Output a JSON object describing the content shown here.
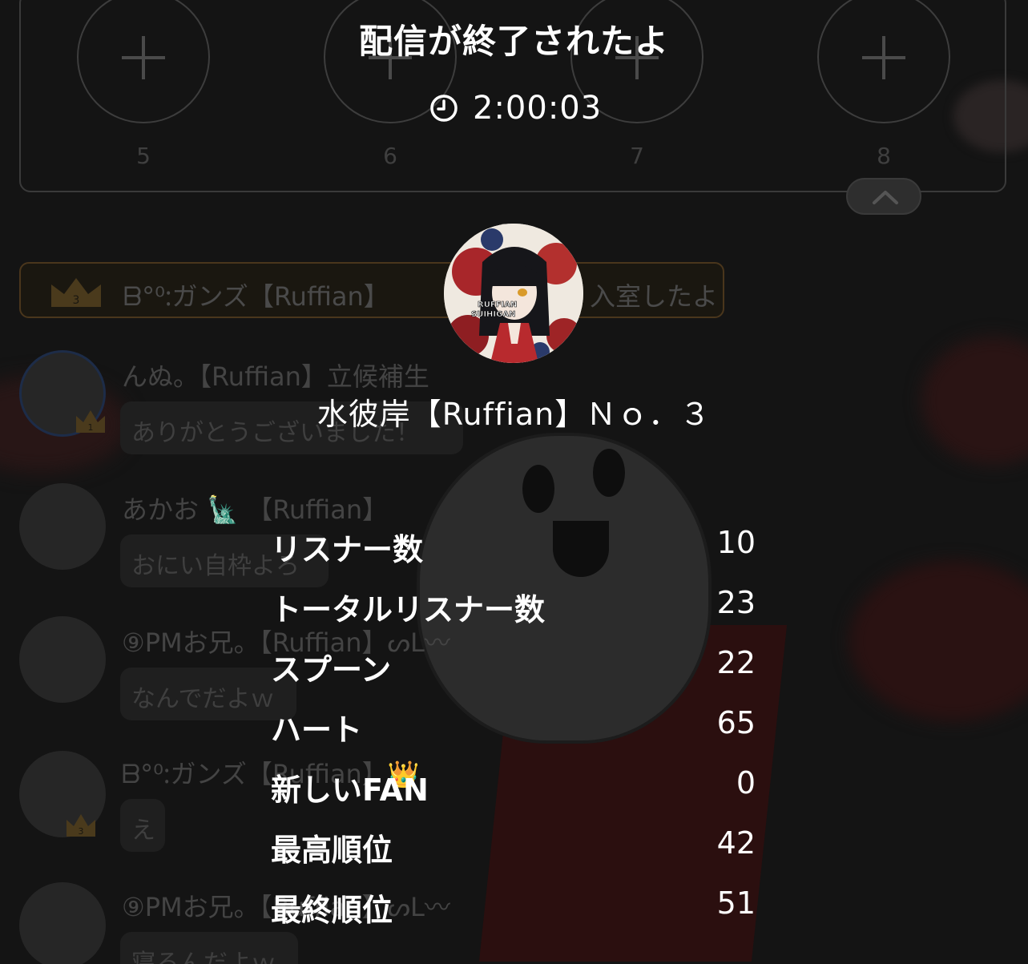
{
  "slots": [
    {
      "number": "5"
    },
    {
      "number": "6"
    },
    {
      "number": "7"
    },
    {
      "number": "8"
    }
  ],
  "entry_notice": {
    "text": "ᗷ°⁰ᱺガンズ【Ruffian】",
    "tail": "入室したよ",
    "crown_rank": "3"
  },
  "chat": [
    {
      "name": "んぬ。【Ruffian】立候補生",
      "message": "ありがとうございました！",
      "badge": "1"
    },
    {
      "name": "あかお 🗽 【Ruffian】",
      "message": "おにい自枠よろ"
    },
    {
      "name": "⑨PMお兄。【Ruffian】ᔕᒪ〰",
      "message": "なんでだよｗ"
    },
    {
      "name": "ᗷ°⁰ᱺガンズ【Ruffian】👑",
      "message": "え",
      "badge": "3"
    },
    {
      "name": "⑨PMお兄。【Ruffian】ᔕᒪ〰",
      "message": "寝るんだよｗ"
    }
  ],
  "summary": {
    "title": "配信が終了されたよ",
    "duration": "2:00:03",
    "streamer_name": "水彼岸【Ruffian】Ｎｏ．３",
    "avatar_text_top": "RUFFIAN",
    "avatar_text_bottom": "SUIHIGAN",
    "stats": [
      {
        "label": "リスナー数",
        "value": "10"
      },
      {
        "label": "トータルリスナー数",
        "value": "23"
      },
      {
        "label": "スプーン",
        "value": "22"
      },
      {
        "label": "ハート",
        "value": "65"
      },
      {
        "label": "新しいFAN",
        "value": "0"
      },
      {
        "label": "最高順位",
        "value": "42"
      },
      {
        "label": "最終順位",
        "value": "51"
      }
    ]
  },
  "icons": {
    "clock": "clock-icon",
    "plus": "plus-icon",
    "chevron_up": "chevron-up-icon",
    "crown": "crown-icon"
  },
  "colors": {
    "background": "#141414",
    "text": "#ffffff",
    "dim_text": "#444444",
    "gold": "#c89a3a"
  }
}
